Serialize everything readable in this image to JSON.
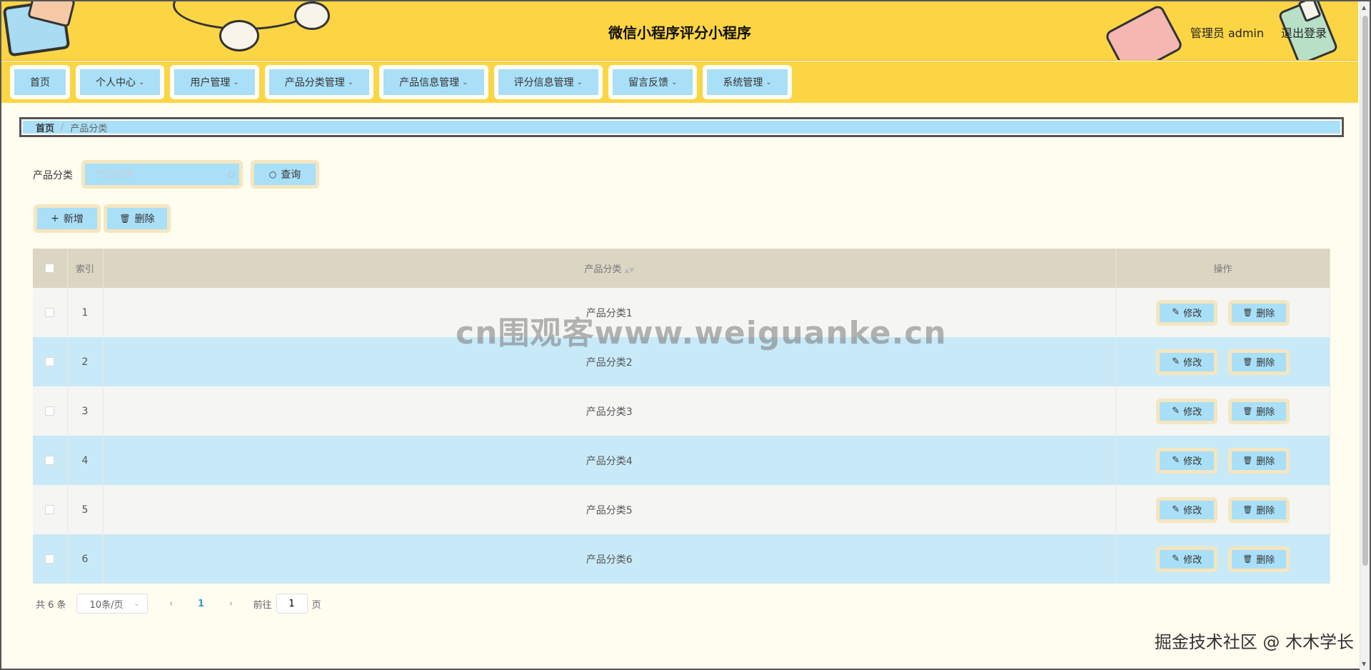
{
  "header": {
    "title": "微信小程序评分小程序",
    "user": "管理员 admin",
    "logout": "退出登录"
  },
  "nav": [
    {
      "label": "首页",
      "has_dropdown": false
    },
    {
      "label": "个人中心",
      "has_dropdown": true
    },
    {
      "label": "用户管理",
      "has_dropdown": true
    },
    {
      "label": "产品分类管理",
      "has_dropdown": true
    },
    {
      "label": "产品信息管理",
      "has_dropdown": true
    },
    {
      "label": "评分信息管理",
      "has_dropdown": true
    },
    {
      "label": "留言反馈",
      "has_dropdown": true
    },
    {
      "label": "系统管理",
      "has_dropdown": true
    }
  ],
  "breadcrumb": {
    "home": "首页",
    "separator": "/",
    "current": "产品分类"
  },
  "search": {
    "label": "产品分类",
    "placeholder": "产品分类",
    "value": "",
    "query_button": "查询"
  },
  "actions": {
    "add": "新增",
    "delete": "删除"
  },
  "table": {
    "columns": [
      "索引",
      "产品分类",
      "操作"
    ],
    "rows": [
      {
        "index": "1",
        "category": "产品分类1"
      },
      {
        "index": "2",
        "category": "产品分类2"
      },
      {
        "index": "3",
        "category": "产品分类3"
      },
      {
        "index": "4",
        "category": "产品分类4"
      },
      {
        "index": "5",
        "category": "产品分类5"
      },
      {
        "index": "6",
        "category": "产品分类6"
      }
    ],
    "row_actions": {
      "edit": "修改",
      "delete": "删除"
    }
  },
  "pagination": {
    "total": "共 6 条",
    "page_size": "10条/页",
    "prev": "‹",
    "current_page": "1",
    "next": "›",
    "goto_label": "前往",
    "goto_value": "1",
    "goto_unit": "页"
  },
  "watermarks": {
    "center": "cn围观客www.weiguanke.cn",
    "corner": "掘金技术社区 @ 木木学长"
  },
  "colors": {
    "header_bg": "#fcd544",
    "button_bg": "#a9dff7",
    "button_border": "#f5e6c0",
    "page_bg": "#fffcf0",
    "table_header_bg": "#dad6c2",
    "row_even_bg": "#c8e9f8",
    "row_odd_bg": "#f5f5f4"
  }
}
